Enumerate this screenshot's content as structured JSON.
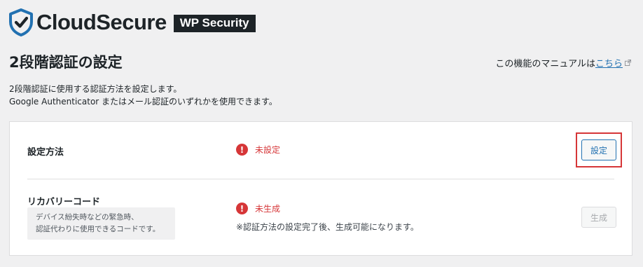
{
  "header": {
    "brand": "CloudSecure",
    "badge": "WP Security",
    "logo_icon": "shield-check-icon",
    "brand_color": "#2271b1"
  },
  "page": {
    "title": "2段階認証の設定",
    "manual_prefix": "この機能のマニュアルは",
    "manual_link": "こちら",
    "description_line1": "2段階認証に使用する認証方法を設定します。",
    "description_line2": "Google Authenticator またはメール認証のいずれかを使用できます。"
  },
  "settings": {
    "method": {
      "label": "設定方法",
      "status_icon": "!",
      "status": "未設定",
      "button": "設定"
    },
    "recovery": {
      "label": "リカバリーコード",
      "hint_line1": "デバイス紛失時などの緊急時、",
      "hint_line2": "認証代わりに使用できるコードです。",
      "status_icon": "!",
      "status": "未生成",
      "note": "※認証方法の設定完了後、生成可能になります。",
      "button": "生成"
    }
  },
  "colors": {
    "error": "#d63638",
    "link": "#2271b1",
    "highlight": "#d63638"
  }
}
